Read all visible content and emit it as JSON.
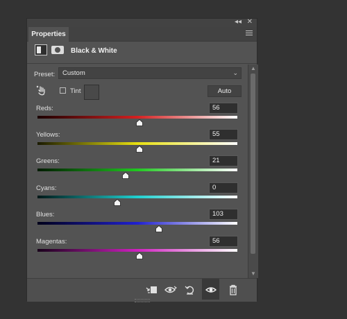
{
  "panel": {
    "tab_label": "Properties",
    "collapse_glyph": "◂◂",
    "close_glyph": "✕",
    "header_title": "Black & White",
    "icons": [
      "adjustment-layer-icon",
      "mask-icon"
    ]
  },
  "preset": {
    "label": "Preset:",
    "value": "Custom"
  },
  "tint": {
    "label": "Tint",
    "checked": false,
    "swatch_color": "#494949"
  },
  "auto_label": "Auto",
  "sliders": [
    {
      "label": "Reds:",
      "value": "56",
      "gradient": [
        "#1a0000",
        "#d42020",
        "#ffffff"
      ]
    },
    {
      "label": "Yellows:",
      "value": "55",
      "gradient": [
        "#1a1a00",
        "#e8e010",
        "#ffffff"
      ]
    },
    {
      "label": "Greens:",
      "value": "21",
      "gradient": [
        "#001a00",
        "#20c820",
        "#ffffff"
      ]
    },
    {
      "label": "Cyans:",
      "value": "0",
      "gradient": [
        "#001818",
        "#20d0d0",
        "#ffffff"
      ]
    },
    {
      "label": "Blues:",
      "value": "103",
      "gradient": [
        "#00001a",
        "#2020d0",
        "#ffffff"
      ]
    },
    {
      "label": "Magentas:",
      "value": "56",
      "gradient": [
        "#18001a",
        "#d020c0",
        "#ffffff"
      ]
    }
  ],
  "slider_range": [
    -200,
    300
  ],
  "bottom_icons": [
    "clip-to-layer-icon",
    "view-previous-state-icon",
    "reset-icon",
    "visibility-icon",
    "delete-icon"
  ]
}
